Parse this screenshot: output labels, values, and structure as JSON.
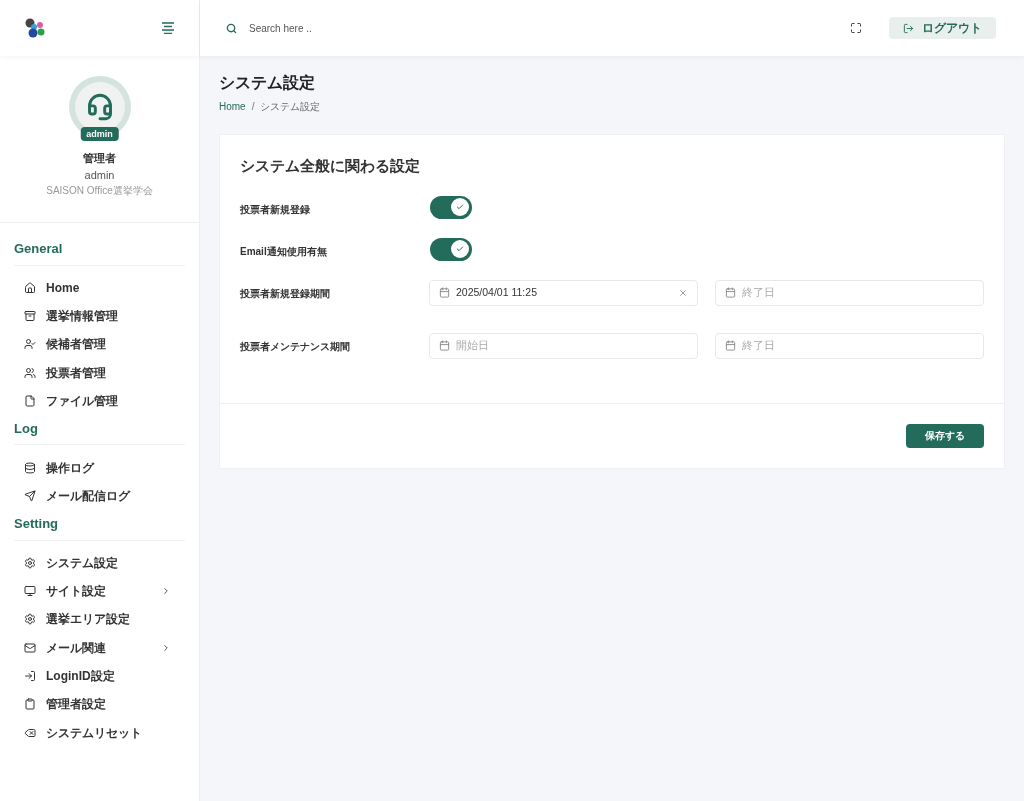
{
  "header": {
    "search": {
      "placeholder": "Search here .."
    },
    "logout": "ログアウト"
  },
  "profile": {
    "badge": "admin",
    "name": "管理者",
    "username": "admin",
    "org": "SAISON Office選挙学会"
  },
  "sidebar": {
    "sections": [
      {
        "title": "General",
        "items": [
          {
            "label": "Home",
            "submenu": false
          },
          {
            "label": "選挙情報管理",
            "submenu": false
          },
          {
            "label": "候補者管理",
            "submenu": false
          },
          {
            "label": "投票者管理",
            "submenu": false
          },
          {
            "label": "ファイル管理",
            "submenu": false
          }
        ]
      },
      {
        "title": "Log",
        "items": [
          {
            "label": "操作ログ",
            "submenu": false
          },
          {
            "label": "メール配信ログ",
            "submenu": false
          }
        ]
      },
      {
        "title": "Setting",
        "items": [
          {
            "label": "システム設定",
            "submenu": false
          },
          {
            "label": "サイト設定",
            "submenu": true
          },
          {
            "label": "選挙エリア設定",
            "submenu": false
          },
          {
            "label": "メール関連",
            "submenu": true
          },
          {
            "label": "LoginID設定",
            "submenu": false
          },
          {
            "label": "管理者設定",
            "submenu": false
          },
          {
            "label": "システムリセット",
            "submenu": false
          }
        ]
      }
    ]
  },
  "page": {
    "title": "システム設定",
    "breadcrumb_separator": "/",
    "breadcrumb": [
      {
        "label": "Home",
        "link": true
      },
      {
        "label": "システム設定",
        "link": false
      }
    ]
  },
  "card": {
    "title": "システム全般に関わる設定",
    "rows": [
      {
        "kind": "toggle",
        "label": "投票者新規登録",
        "on": true
      },
      {
        "kind": "toggle",
        "label": "Email通知使用有無",
        "on": true
      },
      {
        "kind": "daterange",
        "label": "投票者新規登録期間",
        "fields": [
          {
            "value": "2025/04/01 11:25"
          },
          {
            "placeholder": "終了日"
          }
        ]
      },
      {
        "kind": "daterange",
        "label": "投票者メンテナンス期間",
        "fields": [
          {
            "placeholder": "開始日"
          },
          {
            "placeholder": "終了日"
          }
        ]
      }
    ],
    "save": "保存する"
  }
}
